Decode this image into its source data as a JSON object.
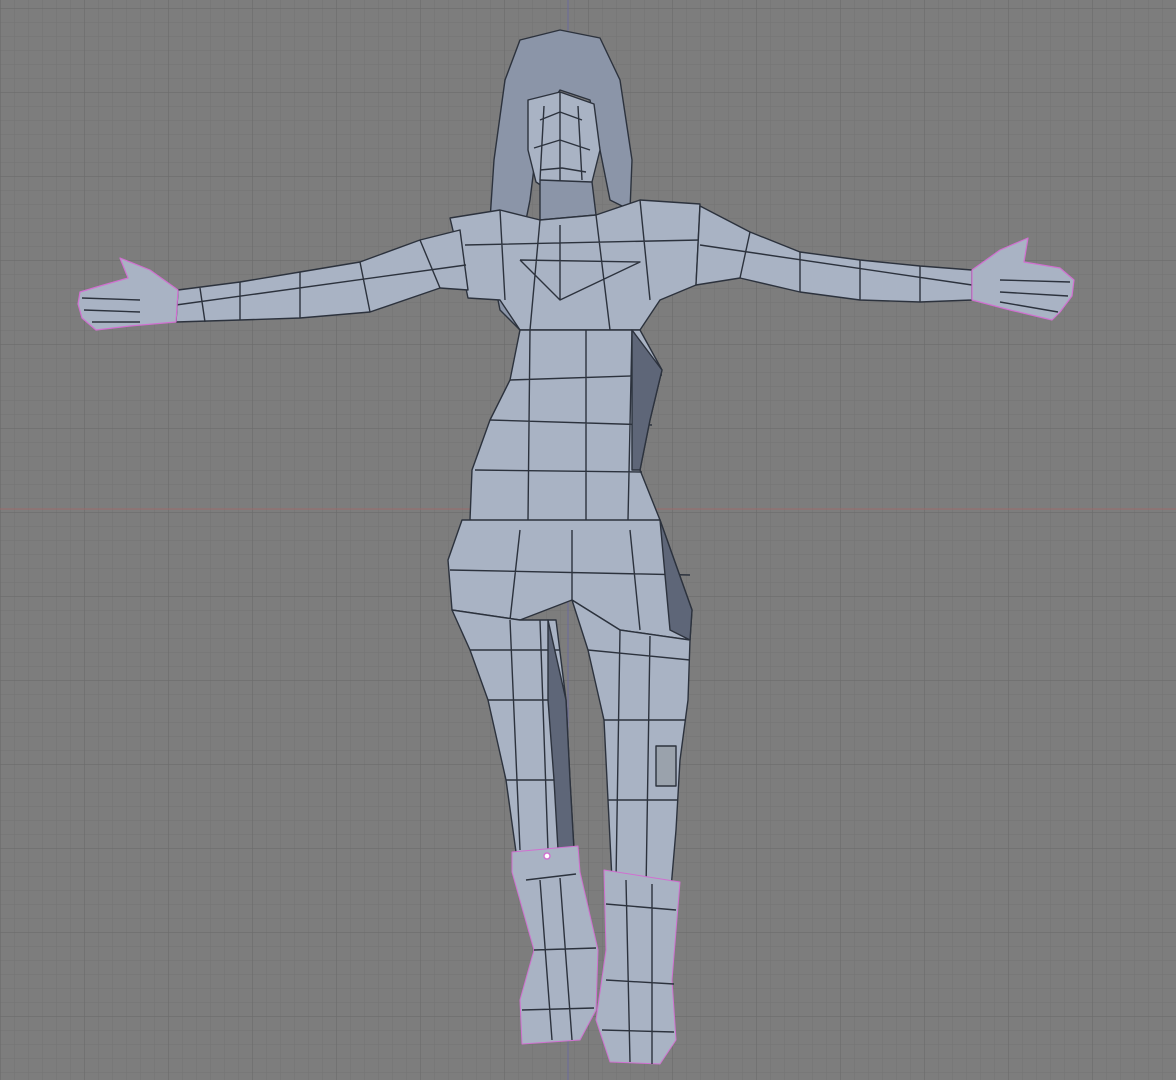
{
  "viewport": {
    "view": "front-orthographic",
    "mode": "edit-mode",
    "shading": "solid",
    "object": "low-poly-female-character-mesh"
  },
  "colors": {
    "background": "#7d7d7d",
    "grid_minor": "#737373",
    "grid_major": "#6a6a6a",
    "axis_x": "#9a6a6a",
    "axis_z": "#6a6a9a",
    "mesh_light": "#a9b3c4",
    "mesh_mid": "#8b95a8",
    "mesh_dark": "#5e6678",
    "wire": "#2c323d",
    "vertex": "#d070d0"
  },
  "icons": {
    "mesh": "character-mesh-icon"
  }
}
